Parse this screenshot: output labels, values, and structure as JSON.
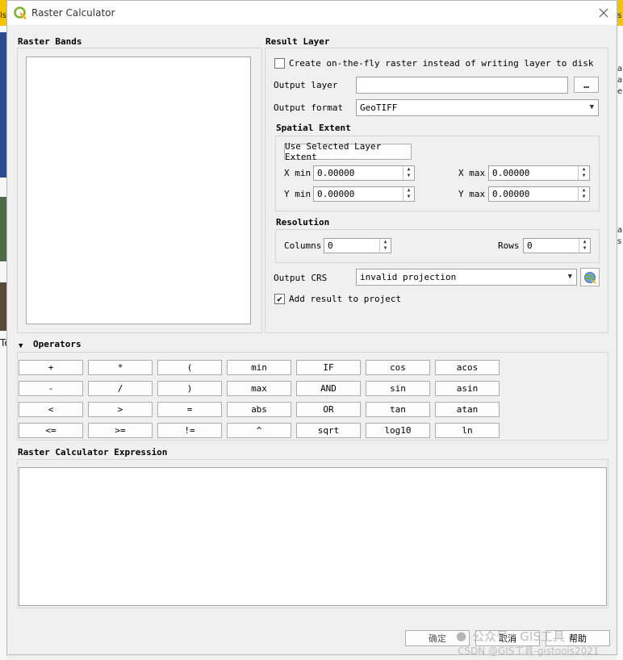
{
  "window": {
    "title": "Raster Calculator"
  },
  "raster_bands": {
    "title": "Raster Bands"
  },
  "result_layer": {
    "title": "Result Layer",
    "onfly_label": "Create on-the-fly raster instead of writing layer to disk",
    "output_layer_label": "Output layer",
    "output_layer_value": "",
    "browse_label": "…",
    "output_format_label": "Output format",
    "output_format_value": "GeoTIFF",
    "spatial_extent_title": "Spatial Extent",
    "use_selected_label": "Use Selected Layer Extent",
    "xmin_label": "X min",
    "xmin_value": "0.00000",
    "xmax_label": "X max",
    "xmax_value": "0.00000",
    "ymin_label": "Y min",
    "ymin_value": "0.00000",
    "ymax_label": "Y max",
    "ymax_value": "0.00000",
    "resolution_title": "Resolution",
    "columns_label": "Columns",
    "columns_value": "0",
    "rows_label": "Rows",
    "rows_value": "0",
    "output_crs_label": "Output CRS",
    "output_crs_value": "invalid projection",
    "add_result_label": "Add result to project",
    "add_result_checked": "✔"
  },
  "operators": {
    "title": "Operators",
    "rows": [
      [
        "+",
        "*",
        "(",
        "min",
        "IF",
        "cos",
        "acos"
      ],
      [
        "-",
        "/",
        ")",
        "max",
        "AND",
        "sin",
        "asin"
      ],
      [
        "<",
        ">",
        "=",
        "abs",
        "OR",
        "tan",
        "atan"
      ],
      [
        "<=",
        ">=",
        "!=",
        "^",
        "sqrt",
        "log10",
        "ln"
      ]
    ]
  },
  "expression": {
    "title": "Raster Calculator Expression",
    "value": ""
  },
  "footer": {
    "ok_label": "确定",
    "cancel_label": "取消",
    "help_label": "帮助"
  },
  "watermark": {
    "line1": "公众号 · GIS工具",
    "line2": "CSDN @GIS工具-gistools2021"
  },
  "background": {
    "left_top": "ls",
    "left_mid": "Te",
    "right_a": "a",
    "right_s": "s",
    "right_e": "e"
  },
  "colors": {
    "accent_yellow": "#f5c400",
    "qgis_green": "#7fb431",
    "qgis_yellow": "#f0b424"
  }
}
